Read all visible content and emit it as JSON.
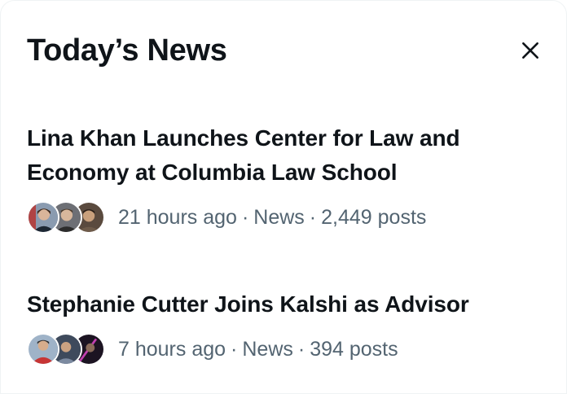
{
  "panel": {
    "title": "Today’s News"
  },
  "news": [
    {
      "headline_line1": "Lina Khan Launches Center for Law and",
      "headline_line2": "Economy at Columbia Law School",
      "time": "21 hours ago",
      "category": "News",
      "posts": "2,449 posts"
    },
    {
      "headline_line1": "Stephanie Cutter Joins Kalshi as Advisor",
      "headline_line2": "",
      "time": "7 hours ago",
      "category": "News",
      "posts": "394 posts"
    }
  ],
  "separator": "·",
  "icons": {
    "close": "close-icon"
  },
  "colors": {
    "text_primary": "#0f1419",
    "text_secondary": "#536471"
  }
}
